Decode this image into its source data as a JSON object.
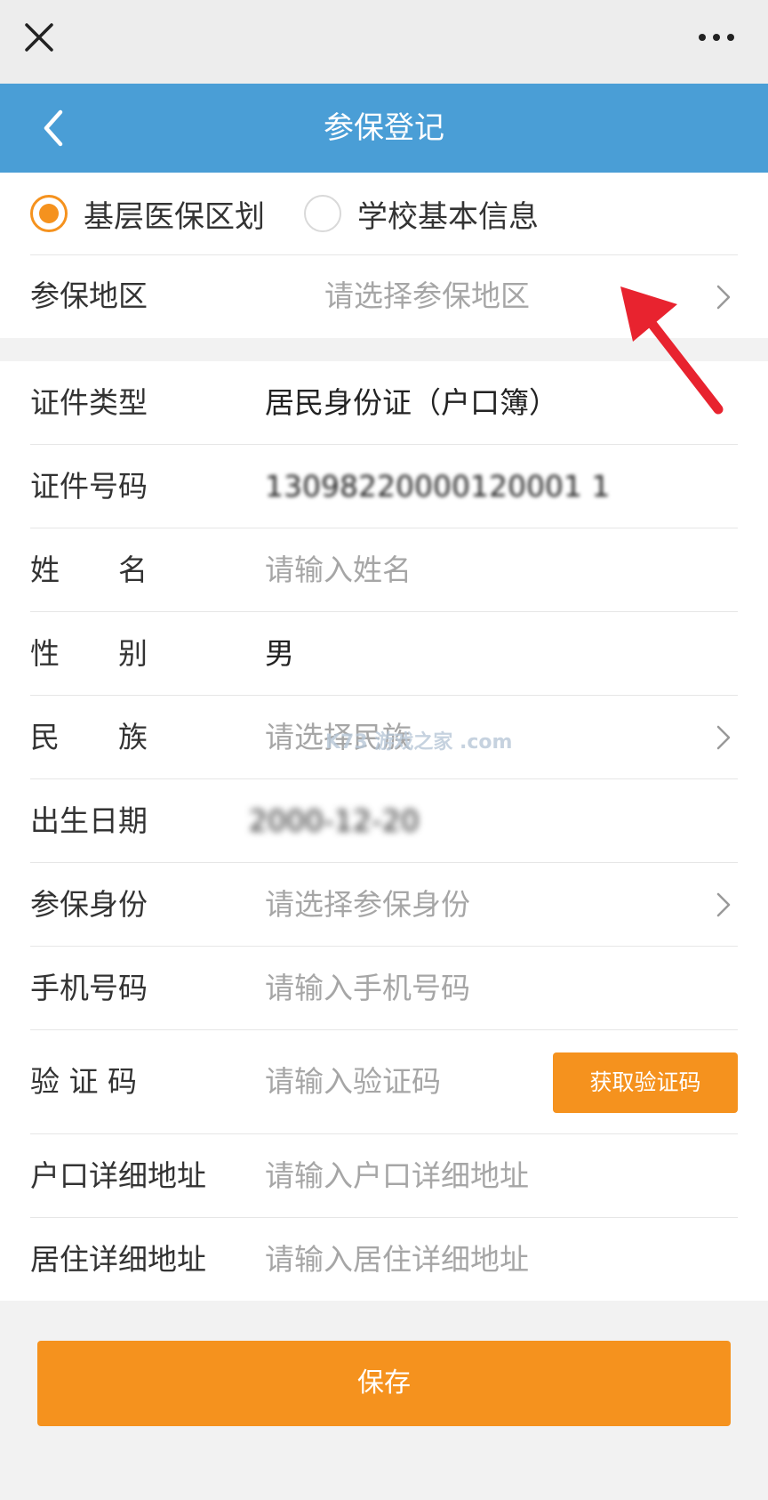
{
  "header": {
    "close_icon": "close-icon",
    "more_icon": "more-icon"
  },
  "navbar": {
    "title": "参保登记",
    "back_icon": "chevron-left-icon",
    "background": "#4a9ed6"
  },
  "region_type": {
    "options": [
      {
        "label": "基层医保区划",
        "checked": true
      },
      {
        "label": "学校基本信息",
        "checked": false
      }
    ]
  },
  "region": {
    "label": "参保地区",
    "placeholder": "请选择参保地区"
  },
  "form": {
    "id_type": {
      "label": "证件类型",
      "value": "居民身份证（户口簿）"
    },
    "id_number": {
      "label": "证件号码",
      "value": "13098220000120001 1"
    },
    "name": {
      "label": "姓　　名",
      "placeholder": "请输入姓名"
    },
    "gender": {
      "label": "性　　别",
      "value": "男"
    },
    "ethnicity": {
      "label": "民　　族",
      "placeholder": "请选择民族"
    },
    "birth_date": {
      "label": "出生日期",
      "value": "2000-12-20"
    },
    "insured_identity": {
      "label": "参保身份",
      "placeholder": "请选择参保身份"
    },
    "phone": {
      "label": "手机号码",
      "placeholder": "请输入手机号码"
    },
    "verify_code": {
      "label": "验 证 码",
      "placeholder": "请输入验证码",
      "button": "获取验证码"
    },
    "hukou_address": {
      "label": "户口详细地址",
      "placeholder": "请输入户口详细地址"
    },
    "residence_address": {
      "label": "居住详细地址",
      "placeholder": "请输入居住详细地址"
    }
  },
  "save_label": "保存",
  "watermark": "K73 游戏之家 .com",
  "accent_color": "#f5921e"
}
